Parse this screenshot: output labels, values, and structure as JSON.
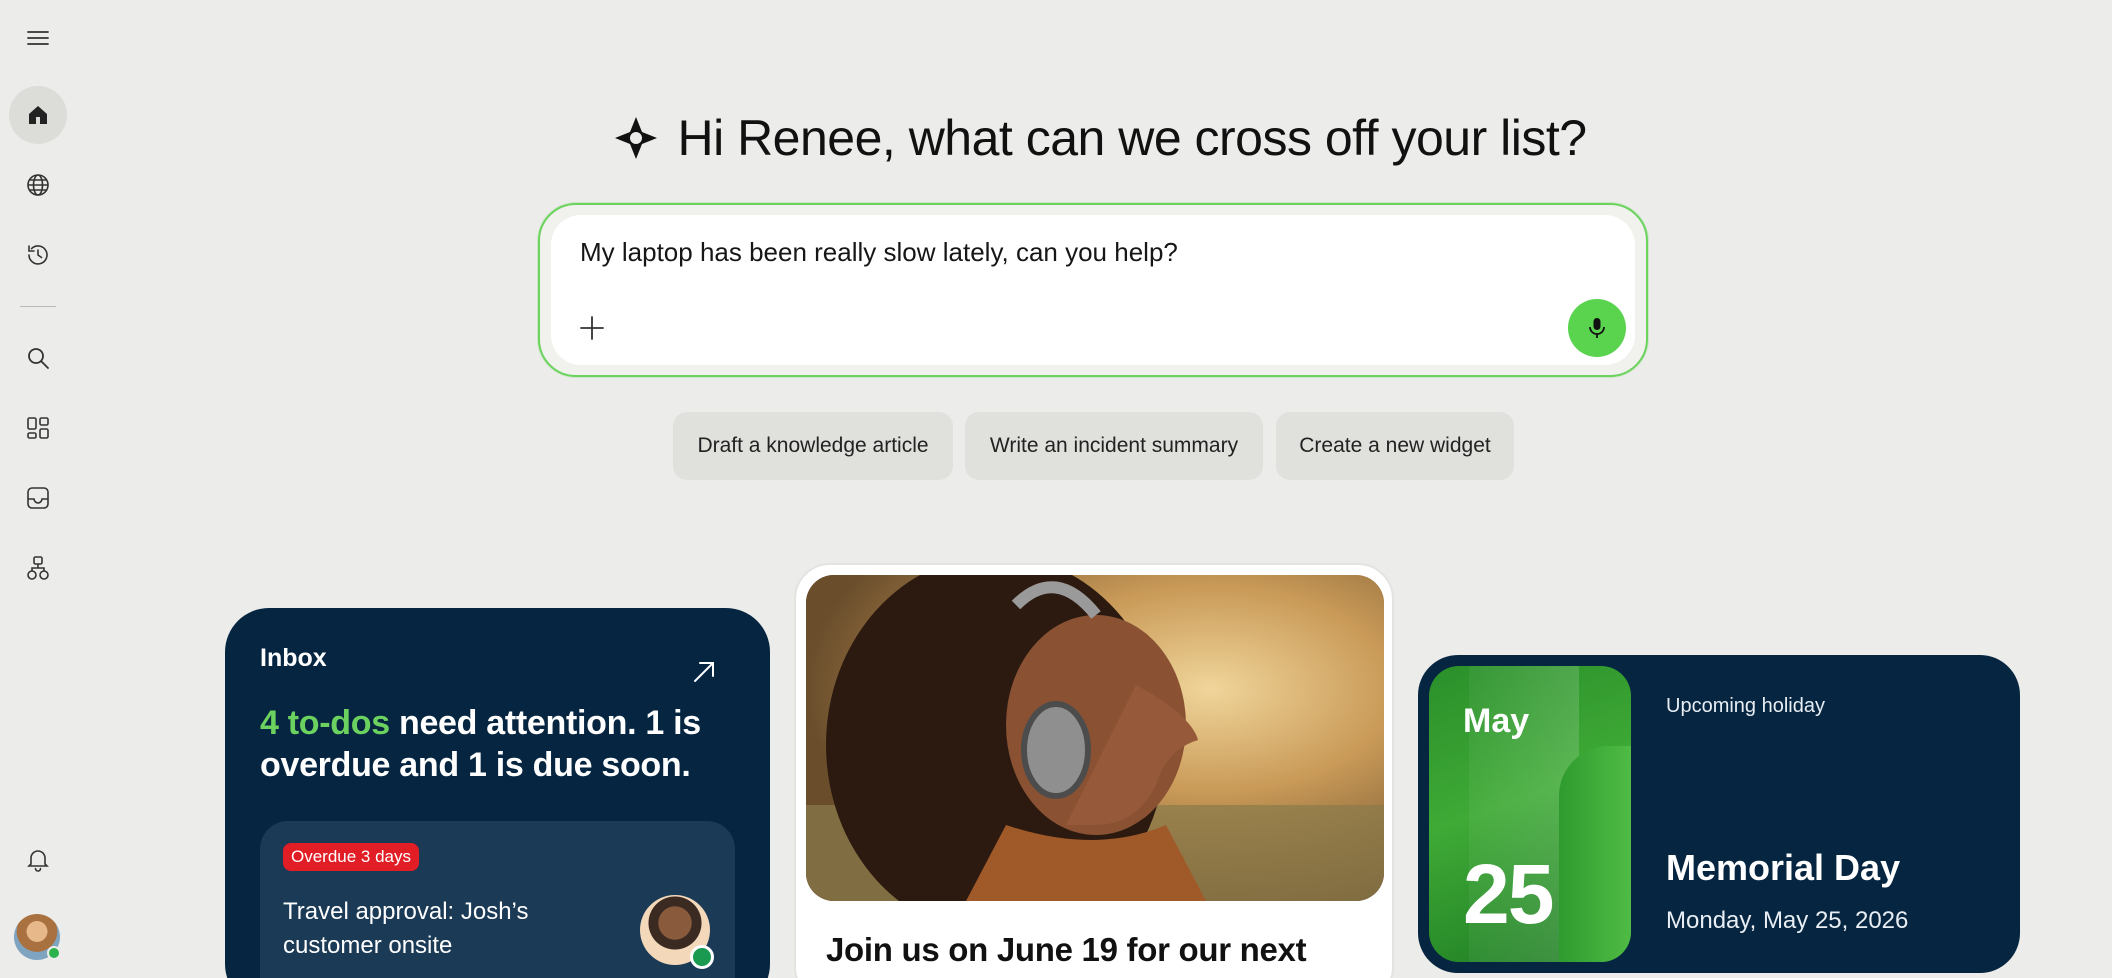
{
  "sidebar": {
    "items": [
      {
        "name": "menu",
        "icon": "hamburger-menu-icon"
      },
      {
        "name": "home",
        "icon": "home-icon",
        "active": true
      },
      {
        "name": "explore",
        "icon": "globe-icon"
      },
      {
        "name": "history",
        "icon": "history-icon"
      },
      {
        "name": "search",
        "icon": "search-icon"
      },
      {
        "name": "dashboards",
        "icon": "dashboard-icon"
      },
      {
        "name": "inbox",
        "icon": "inbox-icon"
      },
      {
        "name": "workflows",
        "icon": "workflow-icon"
      },
      {
        "name": "notifications",
        "icon": "bell-icon"
      }
    ]
  },
  "greeting": {
    "text": "Hi Renee, what can we cross off your list?",
    "icon": "sparkle-icon"
  },
  "prompt": {
    "value": "My laptop has been really slow lately, can you help?",
    "attach_icon": "plus-icon",
    "mic_icon": "microphone-icon",
    "accent": "#5ad34f"
  },
  "chips": [
    {
      "label": "Draft a knowledge article"
    },
    {
      "label": "Write an incident summary"
    },
    {
      "label": "Create a new widget"
    }
  ],
  "inbox_card": {
    "title": "Inbox",
    "headline_highlight": "4 to-dos",
    "headline_rest": " need attention. 1 is overdue and 1 is due soon.",
    "todo": {
      "badge": "Overdue 3 days",
      "text": "Travel approval: Josh’s customer onsite"
    },
    "colors": {
      "background": "#062540",
      "highlight": "#6cd25f",
      "badge": "#e11d26"
    }
  },
  "event_card": {
    "title": "Join us on June 19 for our next"
  },
  "holiday_card": {
    "month": "May",
    "day": "25",
    "label": "Upcoming holiday",
    "name": "Memorial Day",
    "date": "Monday, May 25, 2026"
  }
}
